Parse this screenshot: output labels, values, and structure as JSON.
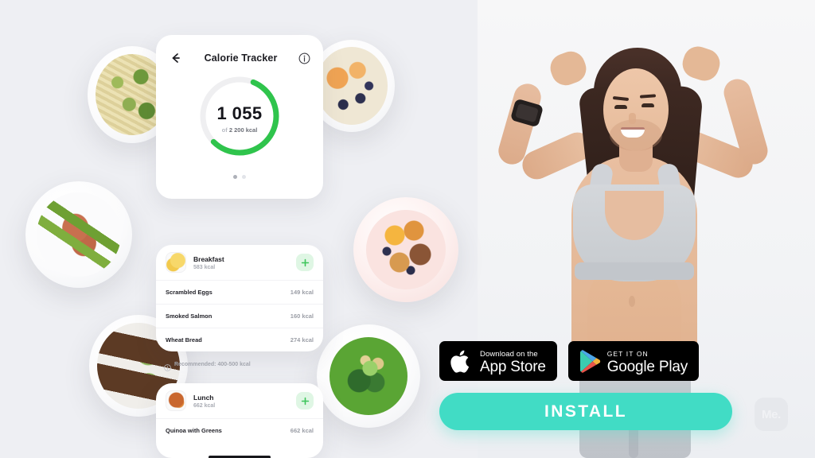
{
  "background": {
    "color": "#eeeff3"
  },
  "hero": {
    "subject": "smiling-woman-hands-behind-head",
    "outfit": "gray sports bra and gray shorts",
    "accessory": "black smartwatch"
  },
  "food_photos": [
    {
      "name": "pesto-pasta-with-basil"
    },
    {
      "name": "bacon-wrapped-asparagus"
    },
    {
      "name": "avocado-toast-with-eggs"
    },
    {
      "name": "oatmeal-with-peach-and-blueberries"
    },
    {
      "name": "pink-plate-pastries-with-blueberries"
    },
    {
      "name": "green-soup-with-croutons"
    }
  ],
  "phone": {
    "header": {
      "back_icon": "arrow-left-icon",
      "title": "Calorie Tracker",
      "info_icon": "info-icon"
    },
    "progress": {
      "consumed": "1 055",
      "goal_prefix": "of",
      "goal": "2 200 kcal",
      "percent": 48,
      "ring_color": "#2fc44c",
      "track_color": "#efeff1"
    },
    "pager": {
      "count": 2,
      "active": 1
    },
    "recommendation": {
      "icon": "info-icon",
      "text": "Recommended: 400-500 kcal"
    },
    "meals": [
      {
        "name": "Breakfast",
        "calories": "583 kcal",
        "thumb": "scrambled-eggs-thumb",
        "add_icon": "plus-icon",
        "items": [
          {
            "name": "Scrambled Eggs",
            "calories": "149 kcal"
          },
          {
            "name": "Smoked Salmon",
            "calories": "160 kcal"
          },
          {
            "name": "Wheat Bread",
            "calories": "274 kcal"
          }
        ]
      },
      {
        "name": "Lunch",
        "calories": "662 kcal",
        "thumb": "quinoa-bowl-thumb",
        "add_icon": "plus-icon",
        "items": [
          {
            "name": "Quinoa with Greens",
            "calories": "662 kcal"
          }
        ]
      }
    ]
  },
  "store_badges": [
    {
      "icon": "apple-logo-icon",
      "small": "Download on the",
      "big": "App Store"
    },
    {
      "icon": "google-play-icon",
      "small": "GET IT ON",
      "big": "Google Play"
    }
  ],
  "cta": {
    "label": "INSTALL",
    "color": "#41dcc5"
  },
  "logo": {
    "text": "Me."
  }
}
